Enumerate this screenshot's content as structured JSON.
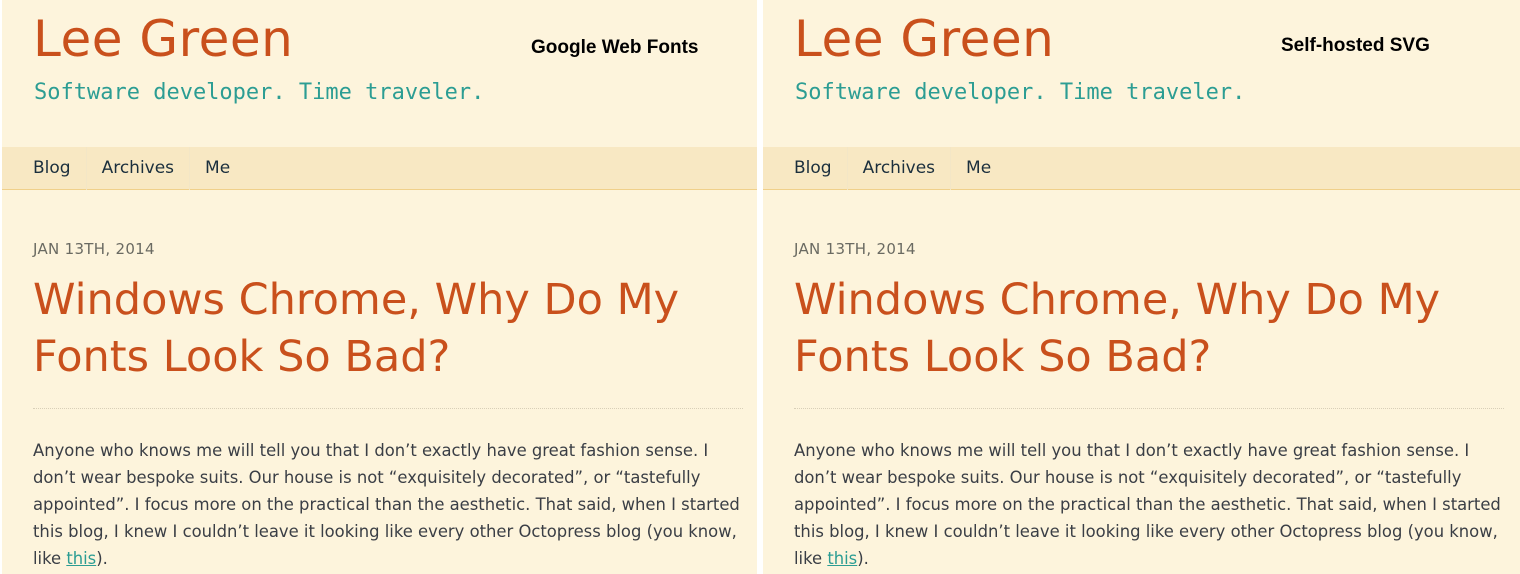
{
  "panels": [
    {
      "compare_label": "Google Web Fonts",
      "site_title": "Lee Green",
      "tagline": "Software developer. Time traveler.",
      "nav": [
        "Blog",
        "Archives",
        "Me"
      ],
      "post": {
        "date": "JAN 13TH, 2014",
        "title": "Windows Chrome, Why Do My Fonts Look So Bad?",
        "body_before_link": "Anyone who knows me will tell you that I don’t exactly have great fashion sense. I don’t wear bespoke suits. Our house is not “exquisitely decorated”, or “tastefully appointed”. I focus more on the practical than the aesthetic. That said, when I started this blog, I knew I couldn’t leave it looking like every other Octopress blog (you know, like ",
        "link_text": "this",
        "body_after_link": ")."
      }
    },
    {
      "compare_label": "Self-hosted SVG",
      "site_title": "Lee Green",
      "tagline": "Software developer. Time traveler.",
      "nav": [
        "Blog",
        "Archives",
        "Me"
      ],
      "post": {
        "date": "JAN 13TH, 2014",
        "title": "Windows Chrome, Why Do My Fonts Look So Bad?",
        "body_before_link": "Anyone who knows me will tell you that I don’t exactly have great fashion sense. I don’t wear bespoke suits. Our house is not “exquisitely decorated”, or “tastefully appointed”. I focus more on the practical than the aesthetic. That said, when I started this blog, I knew I couldn’t leave it looking like every other Octopress blog (you know, like ",
        "link_text": "this",
        "body_after_link": ")."
      }
    }
  ],
  "colors": {
    "background": "#fdf4dc",
    "nav_background": "#f8e8c3",
    "title": "#c9501c",
    "tagline": "#2c9d93",
    "body_text": "#3a3e45",
    "link": "#2c9d93"
  }
}
